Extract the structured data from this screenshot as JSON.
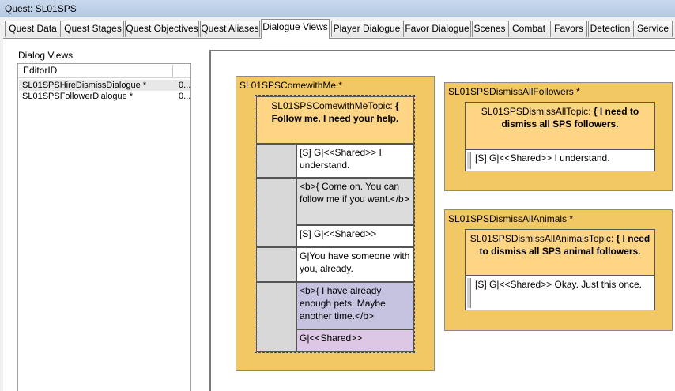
{
  "window": {
    "title": "Quest: SL01SPS"
  },
  "tabs": [
    {
      "label": "Quest Data"
    },
    {
      "label": "Quest Stages"
    },
    {
      "label": "Quest Objectives"
    },
    {
      "label": "Quest Aliases"
    },
    {
      "label": "Dialogue Views"
    },
    {
      "label": "Player Dialogue"
    },
    {
      "label": "Favor Dialogue"
    },
    {
      "label": "Scenes"
    },
    {
      "label": "Combat"
    },
    {
      "label": "Favors"
    },
    {
      "label": "Detection"
    },
    {
      "label": "Service"
    }
  ],
  "active_tab": "Dialogue Views",
  "dialog_views": {
    "label": "Dialog Views",
    "column_header": "EditorID",
    "rows": [
      {
        "name": "SL01SPSHireDismissDialogue *",
        "value": "0..."
      },
      {
        "name": "SL01SPSFollowerDialogue *",
        "value": "0..."
      }
    ]
  },
  "views": {
    "comewithme": {
      "title": "SL01SPSComewithMe *",
      "topic_name": "SL01SPSComewithMeTopic:",
      "topic_text": "{ Follow me. I need your help.",
      "responses": [
        "[S] G|<<Shared>> I understand.",
        "<b>{ Come on. You can follow me if you want.</b>",
        "[S] G|<<Shared>>",
        "G|You have someone with you, already.",
        "<b>{ I have already enough pets. Maybe another time.</b>",
        "G|<<Shared>>"
      ]
    },
    "dismiss_followers": {
      "title": "SL01SPSDismissAllFollowers *",
      "topic_name": "SL01SPSDismissAllTopic:",
      "topic_text": "{ I need to dismiss all SPS followers.",
      "response": "[S] G|<<Shared>> I understand."
    },
    "dismiss_animals": {
      "title": "SL01SPSDismissAllAnimals *",
      "topic_name": "SL01SPSDismissAllAnimalsTopic:",
      "topic_text": "{ I need to dismiss all SPS animal followers.",
      "response": "[S] G|<<Shared>> Okay. Just this once."
    }
  },
  "colors": {
    "view_bg": "#f2c864",
    "topic_bg": "#fdd584",
    "response_gray": "#dcdcdc",
    "response_purple": "#c6c3e0",
    "response_lilac": "#dcc8e4"
  }
}
